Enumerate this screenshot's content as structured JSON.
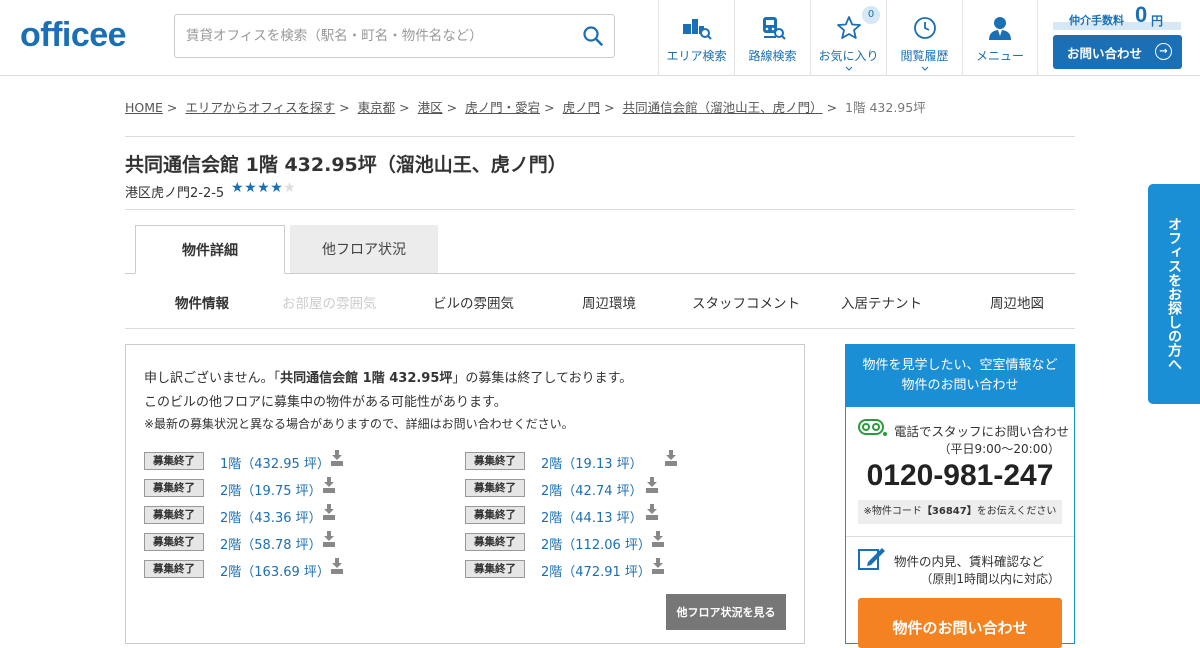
{
  "header": {
    "logo": "officee",
    "search_placeholder": "賃貸オフィスを検索（駅名・町名・物件名など）",
    "nav": [
      {
        "label": "エリア検索",
        "icon": "area-map-icon"
      },
      {
        "label": "路線検索",
        "icon": "train-icon"
      },
      {
        "label": "お気に入り",
        "icon": "star-icon",
        "badge": "0"
      },
      {
        "label": "閲覧履歴",
        "icon": "clock-icon"
      },
      {
        "label": "メニュー",
        "icon": "person-icon"
      }
    ],
    "fee_label": "仲介手数料",
    "fee_value": "0",
    "fee_unit": "円",
    "contact_label": "お問い合わせ"
  },
  "breadcrumb": {
    "items": [
      "HOME",
      "エリアからオフィスを探す",
      "東京都",
      "港区",
      "虎ノ門・愛宕",
      "虎ノ門",
      "共同通信会館（溜池山王、虎ノ門）"
    ],
    "separator": ">",
    "current": "1階 432.95坪"
  },
  "property": {
    "title": "共同通信会館 1階 432.95坪（溜池山王、虎ノ門）",
    "address": "港区虎ノ門2-2-5",
    "rating": 4,
    "rating_max": 5
  },
  "tabs": [
    "物件詳細",
    "他フロア状況"
  ],
  "subnav": [
    "物件情報",
    "お部屋の雰囲気",
    "ビルの雰囲気",
    "周辺環境",
    "スタッフコメント",
    "入居テナント",
    "周辺地図"
  ],
  "notice": {
    "line1_prefix": "申し訳ございません。「",
    "line1_bold": "共同通信会館 1階 432.95坪",
    "line1_suffix": "」の募集は終了しております。",
    "line2": "このビルの他フロアに募集中の物件がある可能性があります。",
    "line3": "※最新の募集状況と異なる場合がありますので、詳細はお問い合わせください。"
  },
  "floor_status_label": "募集終了",
  "floors": [
    "1階（432.95 坪）",
    "2階（19.13 坪）",
    "2階（19.75 坪）",
    "2階（42.74 坪）",
    "2階（43.36 坪）",
    "2階（44.13 坪）",
    "2階（58.78 坪）",
    "2階（112.06 坪）",
    "2階（163.69 坪）",
    "2階（472.91 坪）"
  ],
  "other_floors_button": "他フロア状況を見る",
  "sidebar": {
    "head_line1": "物件を見学したい、空室情報など",
    "head_line2": "物件のお問い合わせ",
    "phone_label": "電話でスタッフにお問い合わせ",
    "hours": "（平日9:00～20:00）",
    "phone": "0120-981-247",
    "code_prefix": "※物件コード",
    "code": "【36847】",
    "code_suffix": "をお伝えください",
    "visit_label": "物件の内見、賃料確認など",
    "visit_sub": "（原則1時間以内に対応）",
    "cta": "物件のお問い合わせ"
  },
  "float_tab": "オフィスをお探しの方へ",
  "colors": {
    "brand": "#1a6fb5",
    "accent": "#1a8fd6",
    "cta": "#f58220"
  }
}
